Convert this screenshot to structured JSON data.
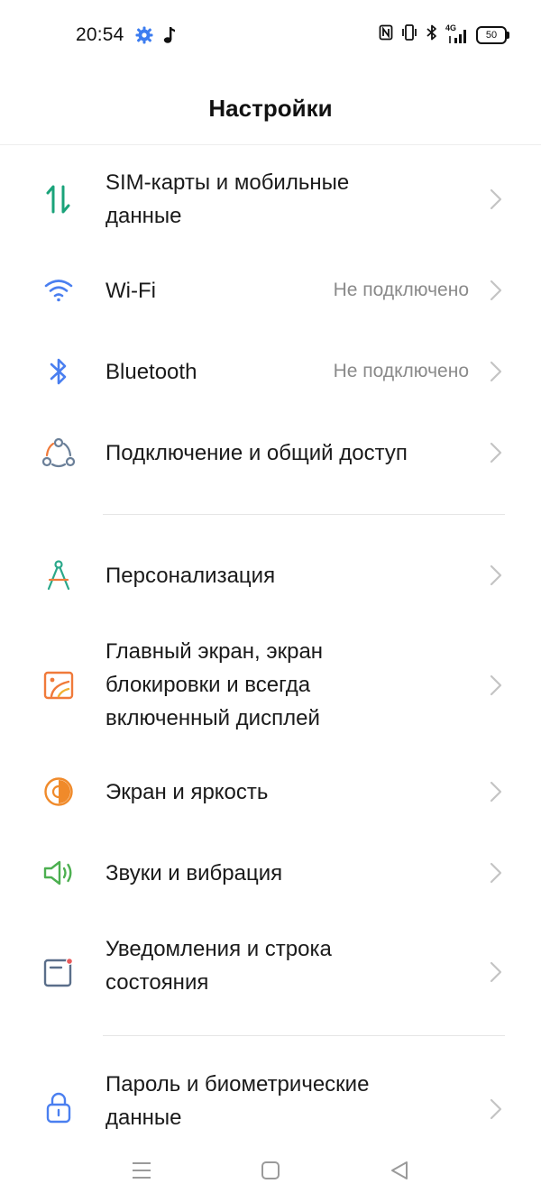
{
  "status_bar": {
    "time": "20:54",
    "left_icons": [
      "gear-icon",
      "music-note-icon"
    ],
    "right_icons": [
      "nfc-icon",
      "vibrate-icon",
      "bluetooth-icon",
      "signal-4g-icon"
    ],
    "network_label": "4G",
    "battery": "50"
  },
  "header": {
    "title": "Настройки"
  },
  "items": [
    {
      "label": "SIM-карты и мобильные данные",
      "value": "",
      "icon": "sim-data-icon",
      "color": "#1aa37a"
    },
    {
      "label": "Wi-Fi",
      "value": "Не подключено",
      "icon": "wifi-icon",
      "color": "#4a7ff0"
    },
    {
      "label": "Bluetooth",
      "value": "Не подключено",
      "icon": "bluetooth-icon",
      "color": "#4a7ff0"
    },
    {
      "label": "Подключение и общий доступ",
      "value": "",
      "icon": "connection-share-icon",
      "color": "#6a7f98"
    },
    {
      "label": "Персонализация",
      "value": "",
      "icon": "compass-icon",
      "color": "#2aa88a"
    },
    {
      "label": "Главный экран, экран блокировки и всегда включенный дисплей",
      "value": "",
      "icon": "wallpaper-icon",
      "color": "#f07a3a"
    },
    {
      "label": "Экран и яркость",
      "value": "",
      "icon": "brightness-icon",
      "color": "#f08a2a"
    },
    {
      "label": "Звуки и вибрация",
      "value": "",
      "icon": "speaker-icon",
      "color": "#4caf50"
    },
    {
      "label": "Уведомления и строка состояния",
      "value": "",
      "icon": "notification-icon",
      "color": "#5a6e8a"
    },
    {
      "label": "Пароль и биометрические данные",
      "value": "",
      "icon": "lock-icon",
      "color": "#4a7ff0"
    }
  ],
  "nav_bar": [
    "menu-icon",
    "home-icon",
    "back-icon"
  ]
}
